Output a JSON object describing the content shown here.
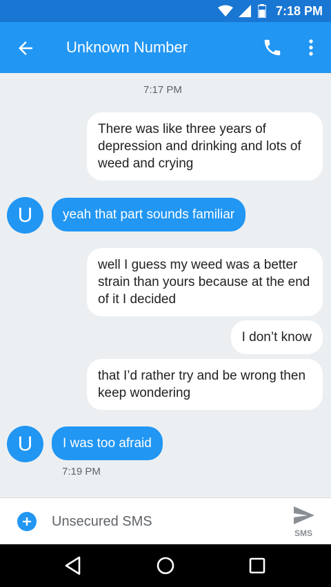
{
  "status_bar": {
    "time": "7:18 PM"
  },
  "app_bar": {
    "title": "Unknown Number"
  },
  "conversation": {
    "timestamp_top": "7:17 PM",
    "timestamp_bottom": "7:19 PM",
    "messages": [
      {
        "direction": "outgoing",
        "text": "There was like three years of depression and drinking and lots of weed and crying"
      },
      {
        "direction": "incoming",
        "avatar": "U",
        "text": "yeah that part sounds familiar"
      },
      {
        "direction": "outgoing",
        "text": "well I guess my weed was a better strain than yours because at the end of it I decided"
      },
      {
        "direction": "outgoing",
        "text": "I don’t know"
      },
      {
        "direction": "outgoing",
        "text": "that I’d rather try and be wrong then keep wondering"
      },
      {
        "direction": "incoming",
        "avatar": "U",
        "text": "I was too afraid"
      }
    ]
  },
  "compose": {
    "placeholder": "Unsecured SMS",
    "send_label": "SMS"
  },
  "icons": {
    "status": [
      "wifi-icon",
      "signal-icon",
      "battery-icon"
    ],
    "app_bar": [
      "back-arrow-icon",
      "phone-icon",
      "more-vert-icon"
    ],
    "compose": [
      "add-icon",
      "send-icon"
    ],
    "nav": [
      "back-triangle-icon",
      "home-circle-icon",
      "recents-square-icon"
    ]
  },
  "colors": {
    "primary": "#2196f3",
    "primary_dark": "#1976d2",
    "background": "#eceff1"
  }
}
